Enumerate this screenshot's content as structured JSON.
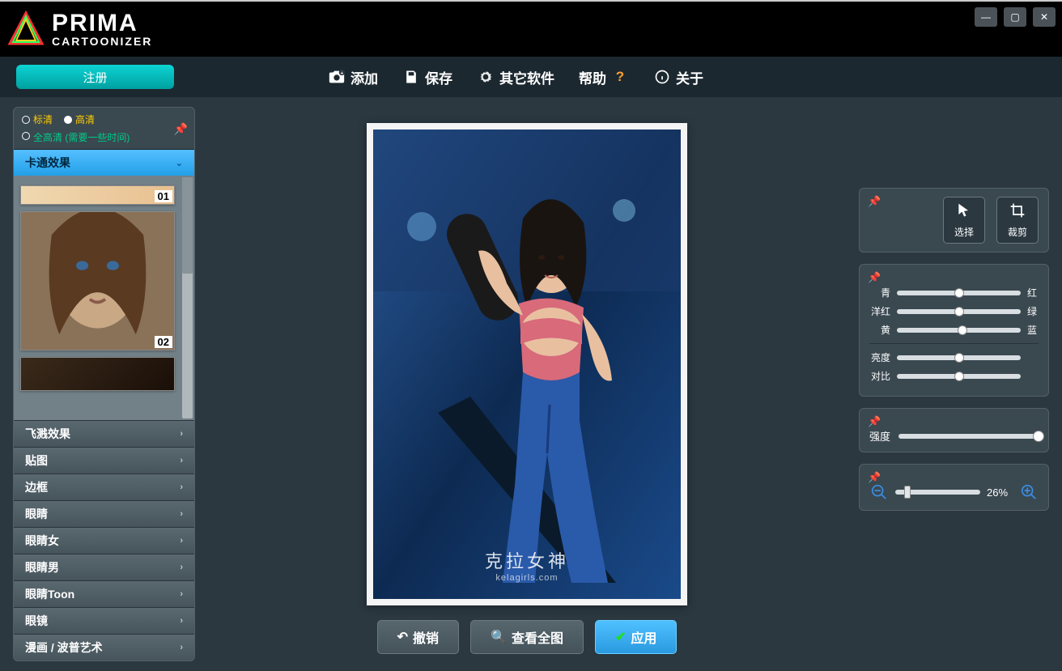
{
  "app": {
    "name_primary": "PRIMA",
    "name_sub": "CARTOONIZER"
  },
  "window": {
    "minimize": "—",
    "maximize": "▢",
    "close": "✕"
  },
  "toolbar": {
    "register": "注册",
    "add": "添加",
    "save": "保存",
    "other": "其它软件",
    "help": "帮助",
    "about": "关于"
  },
  "sidebar": {
    "quality": {
      "sd": "标清",
      "hd": "高清",
      "full_hd": "全高清 (需要一些时间)"
    },
    "accordion_active": "卡通效果",
    "effects": [
      {
        "id": "01"
      },
      {
        "id": "02"
      }
    ],
    "categories": [
      "飞溅效果",
      "贴图",
      "边框",
      "眼睛",
      "眼睛女",
      "眼睛男",
      "眼睛Toon",
      "眼镜",
      "漫画 / 波普艺术"
    ]
  },
  "canvas": {
    "watermark_title": "克拉女神",
    "watermark_sub": "kelagirls.com"
  },
  "actions": {
    "undo": "撤销",
    "view_full": "查看全图",
    "apply": "应用"
  },
  "tools": {
    "select": "选择",
    "crop": "裁剪"
  },
  "color_sliders": {
    "cyan": "青",
    "red": "红",
    "magenta": "洋红",
    "green": "绿",
    "yellow": "黄",
    "blue": "蓝",
    "brightness": "亮度",
    "contrast": "对比",
    "positions": {
      "cyan": 50,
      "magenta": 50,
      "yellow": 53,
      "brightness": 50,
      "contrast": 50
    }
  },
  "intensity": {
    "label": "强度",
    "position": 100
  },
  "zoom": {
    "value": "26%",
    "position": 14
  }
}
